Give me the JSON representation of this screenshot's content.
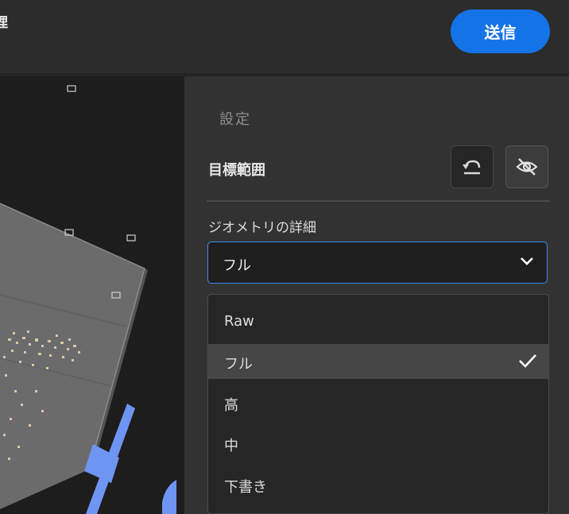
{
  "header": {
    "title_fragment": "理",
    "send_label": "送信"
  },
  "settings": {
    "section_title": "設定",
    "target_label": "目標範囲",
    "geometry_label": "ジオメトリの詳細",
    "geometry_selected": "フル",
    "geometry_options": [
      "Raw",
      "フル",
      "高",
      "中",
      "下書き"
    ]
  },
  "colors": {
    "accent": "#1473e6",
    "focus_border": "#3e8ef7",
    "gizmo": "#6f95f2"
  },
  "icons": [
    "undo-icon",
    "eye-off-icon",
    "chevron-down-icon",
    "checkmark-icon",
    "camera-icon"
  ]
}
